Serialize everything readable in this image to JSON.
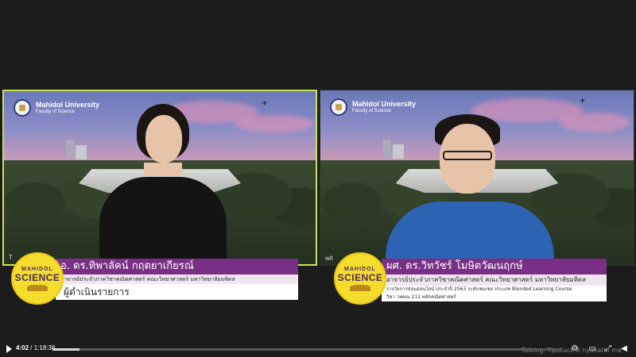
{
  "status": {
    "talking": "Talking: Tipstuck 8 nyakatin me"
  },
  "tiles": [
    {
      "university": "Mahidol University",
      "faculty": "Faculty of Science",
      "name": "อ. ดร.ทิพาลัคน์ กฤตยาเกียรณ์",
      "role": "อาจารย์ประจำภาควิชาคณิตศาสตร์ คณะวิทยาศาสตร์ มหาวิทยาลัยมหิดล",
      "subtitle": "ผู้ดำเนินรายการ",
      "tag": "T",
      "badge_top": "MAHIDOL",
      "badge_main": "SCIENCE"
    },
    {
      "university": "Mahidol University",
      "faculty": "Faculty of Science",
      "name": "ผศ. ดร.วิทวัชร์   โมษิตวัฒนฤกษ์",
      "role": "อาจารย์ประจำภาควิชาคณิตศาสตร์ คณะวิทยาศาสตร์ มหาวิทยาลัยมหิดล",
      "desc_line1": "รางวัลการสอนออนไลน์ ประจำปี 2563 ระดับชมเชย ประเภท Blended Learning Course",
      "desc_line2": "วิชา วทคณ 211 หลักคณิตศาสตร์",
      "tag": "wit",
      "badge_top": "MAHIDOL",
      "badge_main": "SCIENCE"
    }
  ],
  "player": {
    "current_time": "4:02",
    "duration": "/ 1:18:38",
    "progress": 0.053,
    "icons": [
      "play-icon",
      "settings-icon",
      "miniplayer-icon",
      "expand-icon",
      "fullscreen-icon",
      "volume-icon"
    ]
  },
  "colors": {
    "active_speaker_border": "#c8e64a",
    "lower_third_purple": "#7a2f86",
    "badge_yellow": "#f6dc2c"
  }
}
